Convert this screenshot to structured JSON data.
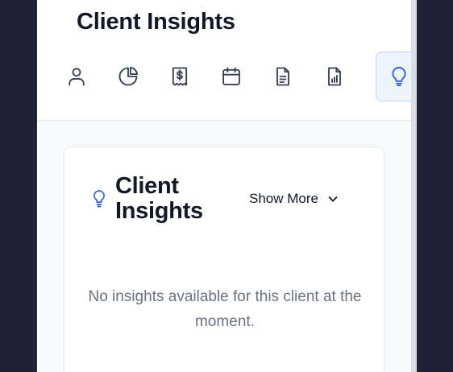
{
  "header": {
    "title": "Client Insights"
  },
  "tabs": [
    {
      "icon": "user-icon",
      "active": false
    },
    {
      "icon": "pie-chart-icon",
      "active": false
    },
    {
      "icon": "receipt-dollar-icon",
      "active": false
    },
    {
      "icon": "calendar-icon",
      "active": false
    },
    {
      "icon": "document-icon",
      "active": false
    },
    {
      "icon": "report-chart-icon",
      "active": false
    },
    {
      "icon": "lightbulb-icon",
      "active": true
    }
  ],
  "card": {
    "title": "Client Insights",
    "show_more_label": "Show More",
    "empty_message": "No insights available for this client at the moment."
  },
  "colors": {
    "accent": "#2f5fe0",
    "active_tab_bg": "#eef4fd",
    "backdrop": "#1f2335"
  }
}
